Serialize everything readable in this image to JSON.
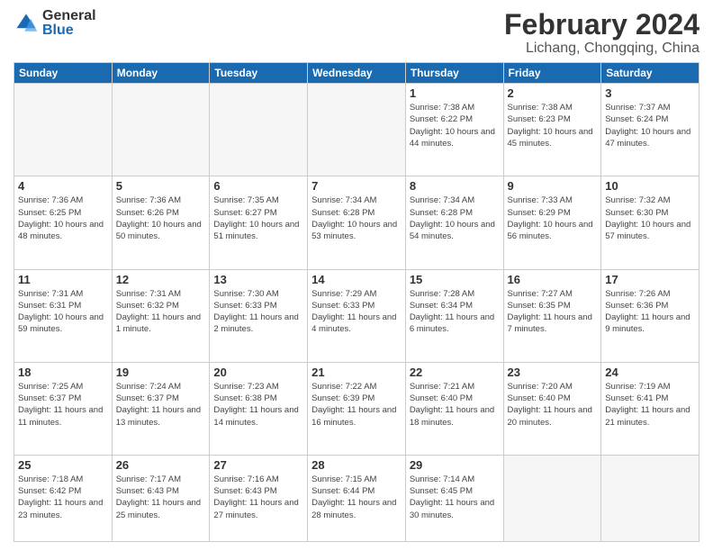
{
  "logo": {
    "general": "General",
    "blue": "Blue"
  },
  "title": "February 2024",
  "location": "Lichang, Chongqing, China",
  "days_of_week": [
    "Sunday",
    "Monday",
    "Tuesday",
    "Wednesday",
    "Thursday",
    "Friday",
    "Saturday"
  ],
  "weeks": [
    [
      {
        "day": "",
        "info": ""
      },
      {
        "day": "",
        "info": ""
      },
      {
        "day": "",
        "info": ""
      },
      {
        "day": "",
        "info": ""
      },
      {
        "day": "1",
        "info": "Sunrise: 7:38 AM\nSunset: 6:22 PM\nDaylight: 10 hours\nand 44 minutes."
      },
      {
        "day": "2",
        "info": "Sunrise: 7:38 AM\nSunset: 6:23 PM\nDaylight: 10 hours\nand 45 minutes."
      },
      {
        "day": "3",
        "info": "Sunrise: 7:37 AM\nSunset: 6:24 PM\nDaylight: 10 hours\nand 47 minutes."
      }
    ],
    [
      {
        "day": "4",
        "info": "Sunrise: 7:36 AM\nSunset: 6:25 PM\nDaylight: 10 hours\nand 48 minutes."
      },
      {
        "day": "5",
        "info": "Sunrise: 7:36 AM\nSunset: 6:26 PM\nDaylight: 10 hours\nand 50 minutes."
      },
      {
        "day": "6",
        "info": "Sunrise: 7:35 AM\nSunset: 6:27 PM\nDaylight: 10 hours\nand 51 minutes."
      },
      {
        "day": "7",
        "info": "Sunrise: 7:34 AM\nSunset: 6:28 PM\nDaylight: 10 hours\nand 53 minutes."
      },
      {
        "day": "8",
        "info": "Sunrise: 7:34 AM\nSunset: 6:28 PM\nDaylight: 10 hours\nand 54 minutes."
      },
      {
        "day": "9",
        "info": "Sunrise: 7:33 AM\nSunset: 6:29 PM\nDaylight: 10 hours\nand 56 minutes."
      },
      {
        "day": "10",
        "info": "Sunrise: 7:32 AM\nSunset: 6:30 PM\nDaylight: 10 hours\nand 57 minutes."
      }
    ],
    [
      {
        "day": "11",
        "info": "Sunrise: 7:31 AM\nSunset: 6:31 PM\nDaylight: 10 hours\nand 59 minutes."
      },
      {
        "day": "12",
        "info": "Sunrise: 7:31 AM\nSunset: 6:32 PM\nDaylight: 11 hours\nand 1 minute."
      },
      {
        "day": "13",
        "info": "Sunrise: 7:30 AM\nSunset: 6:33 PM\nDaylight: 11 hours\nand 2 minutes."
      },
      {
        "day": "14",
        "info": "Sunrise: 7:29 AM\nSunset: 6:33 PM\nDaylight: 11 hours\nand 4 minutes."
      },
      {
        "day": "15",
        "info": "Sunrise: 7:28 AM\nSunset: 6:34 PM\nDaylight: 11 hours\nand 6 minutes."
      },
      {
        "day": "16",
        "info": "Sunrise: 7:27 AM\nSunset: 6:35 PM\nDaylight: 11 hours\nand 7 minutes."
      },
      {
        "day": "17",
        "info": "Sunrise: 7:26 AM\nSunset: 6:36 PM\nDaylight: 11 hours\nand 9 minutes."
      }
    ],
    [
      {
        "day": "18",
        "info": "Sunrise: 7:25 AM\nSunset: 6:37 PM\nDaylight: 11 hours\nand 11 minutes."
      },
      {
        "day": "19",
        "info": "Sunrise: 7:24 AM\nSunset: 6:37 PM\nDaylight: 11 hours\nand 13 minutes."
      },
      {
        "day": "20",
        "info": "Sunrise: 7:23 AM\nSunset: 6:38 PM\nDaylight: 11 hours\nand 14 minutes."
      },
      {
        "day": "21",
        "info": "Sunrise: 7:22 AM\nSunset: 6:39 PM\nDaylight: 11 hours\nand 16 minutes."
      },
      {
        "day": "22",
        "info": "Sunrise: 7:21 AM\nSunset: 6:40 PM\nDaylight: 11 hours\nand 18 minutes."
      },
      {
        "day": "23",
        "info": "Sunrise: 7:20 AM\nSunset: 6:40 PM\nDaylight: 11 hours\nand 20 minutes."
      },
      {
        "day": "24",
        "info": "Sunrise: 7:19 AM\nSunset: 6:41 PM\nDaylight: 11 hours\nand 21 minutes."
      }
    ],
    [
      {
        "day": "25",
        "info": "Sunrise: 7:18 AM\nSunset: 6:42 PM\nDaylight: 11 hours\nand 23 minutes."
      },
      {
        "day": "26",
        "info": "Sunrise: 7:17 AM\nSunset: 6:43 PM\nDaylight: 11 hours\nand 25 minutes."
      },
      {
        "day": "27",
        "info": "Sunrise: 7:16 AM\nSunset: 6:43 PM\nDaylight: 11 hours\nand 27 minutes."
      },
      {
        "day": "28",
        "info": "Sunrise: 7:15 AM\nSunset: 6:44 PM\nDaylight: 11 hours\nand 28 minutes."
      },
      {
        "day": "29",
        "info": "Sunrise: 7:14 AM\nSunset: 6:45 PM\nDaylight: 11 hours\nand 30 minutes."
      },
      {
        "day": "",
        "info": ""
      },
      {
        "day": "",
        "info": ""
      }
    ]
  ]
}
